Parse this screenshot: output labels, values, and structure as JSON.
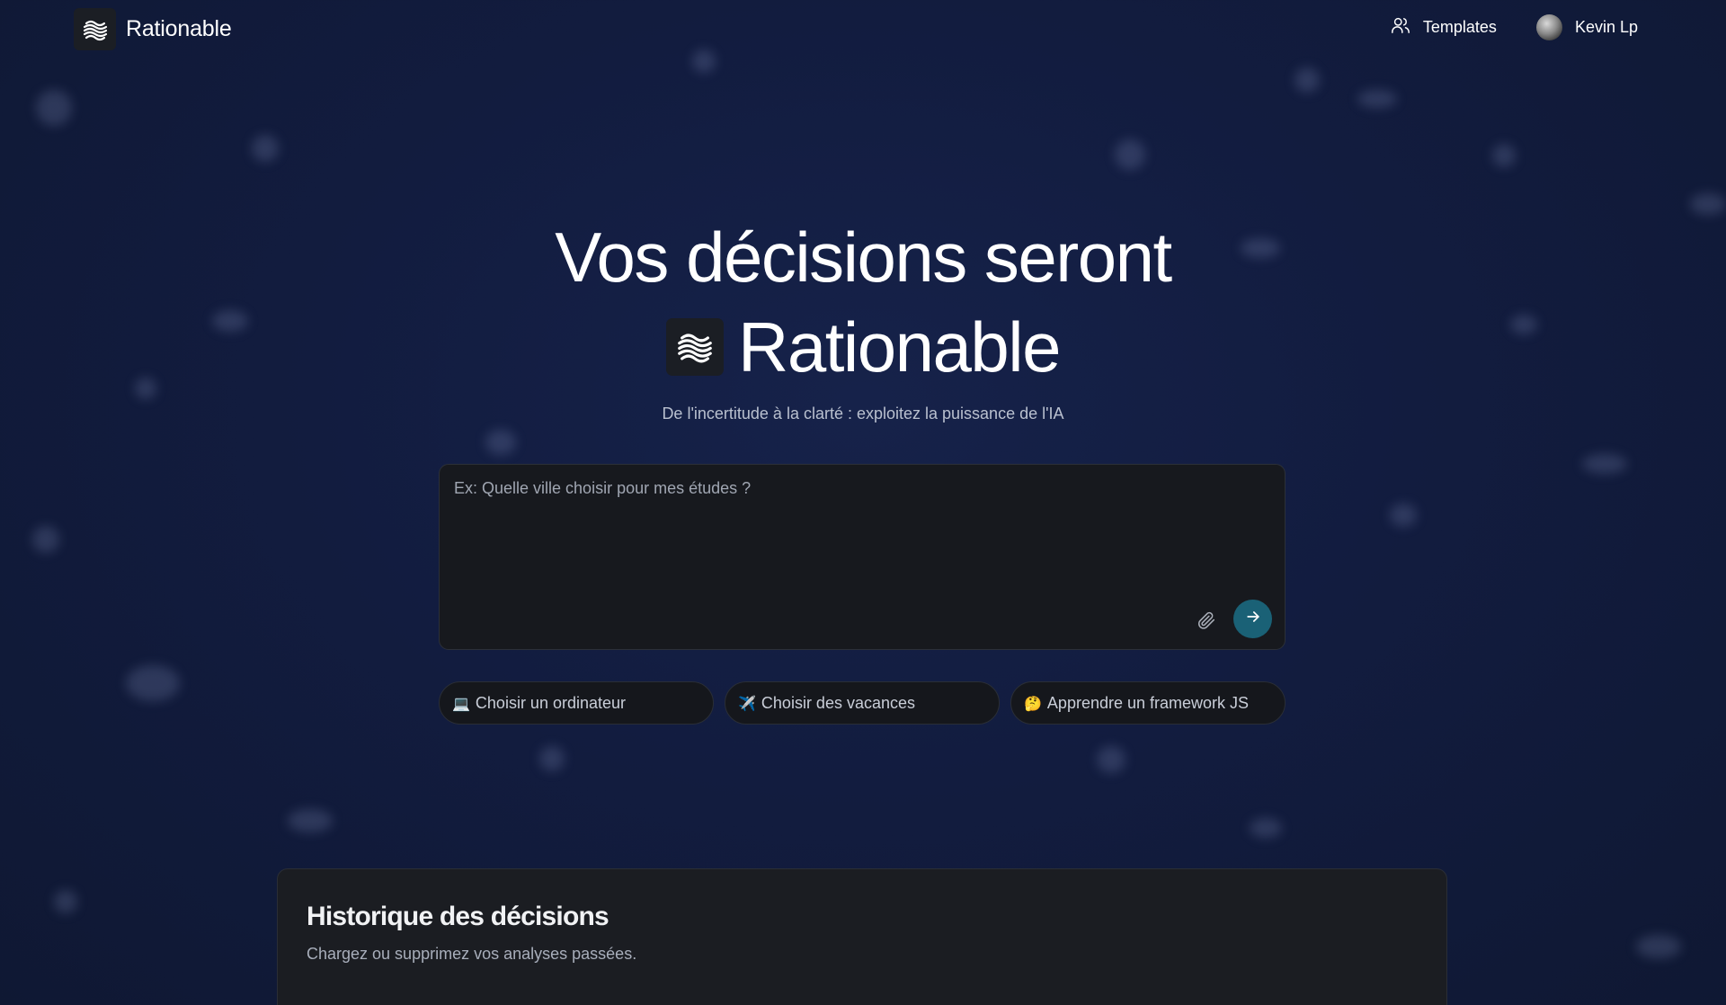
{
  "header": {
    "brand_name": "Rationable",
    "templates_label": "Templates",
    "user_name": "Kevin Lp",
    "icons": {
      "logo": "wave-logo-icon",
      "templates": "users-icon",
      "avatar": "moon-avatar"
    }
  },
  "hero": {
    "line1": "Vos décisions seront",
    "brand": "Rationable",
    "subtitle": "De l'incertitude à la clarté : exploitez la puissance de l'IA"
  },
  "prompt": {
    "placeholder": "Ex: Quelle ville choisir pour mes études ?",
    "value": "",
    "icons": {
      "attach": "paperclip-icon",
      "send": "arrow-right-icon"
    }
  },
  "suggestions": [
    {
      "emoji": "💻",
      "label": "Choisir un ordinateur"
    },
    {
      "emoji": "✈️",
      "label": "Choisir des vacances"
    },
    {
      "emoji": "🤔",
      "label": "Apprendre un framework JS"
    }
  ],
  "history": {
    "title": "Historique des décisions",
    "subtitle": "Chargez ou supprimez vos analyses passées."
  },
  "colors": {
    "background": "#121c3f",
    "panel": "#17191e",
    "send_button": "#1a6176",
    "text_primary": "#ffffff",
    "text_muted": "#b9c0cf"
  }
}
